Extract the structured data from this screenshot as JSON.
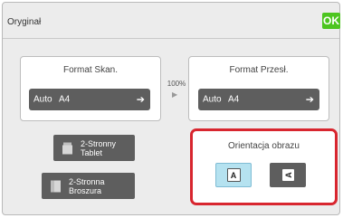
{
  "header": {
    "title": "Oryginał",
    "ok_label": "OK"
  },
  "scan_size": {
    "label": "Format Skan.",
    "mode": "Auto",
    "paper": "A4"
  },
  "ratio": {
    "value": "100%"
  },
  "send_size": {
    "label": "Format Przesł.",
    "mode": "Auto",
    "paper": "A4"
  },
  "duplex": [
    {
      "line1": "2-Stronny",
      "line2": "Tablet",
      "icon": "tablet-document-icon"
    },
    {
      "line1": "2-Stronna",
      "line2": "Broszura",
      "icon": "booklet-document-icon"
    }
  ],
  "orientation": {
    "label": "Orientacja obrazu",
    "options": [
      {
        "glyph": "A",
        "icon": "upright-orientation-icon",
        "selected": true
      },
      {
        "glyph": "A",
        "icon": "rotated-orientation-icon",
        "selected": false
      }
    ]
  },
  "colors": {
    "ok_green": "#4cc51f",
    "highlight_red": "#d8262f",
    "selected_blue": "#b5e2f0",
    "button_dark": "#5e5e5e"
  }
}
